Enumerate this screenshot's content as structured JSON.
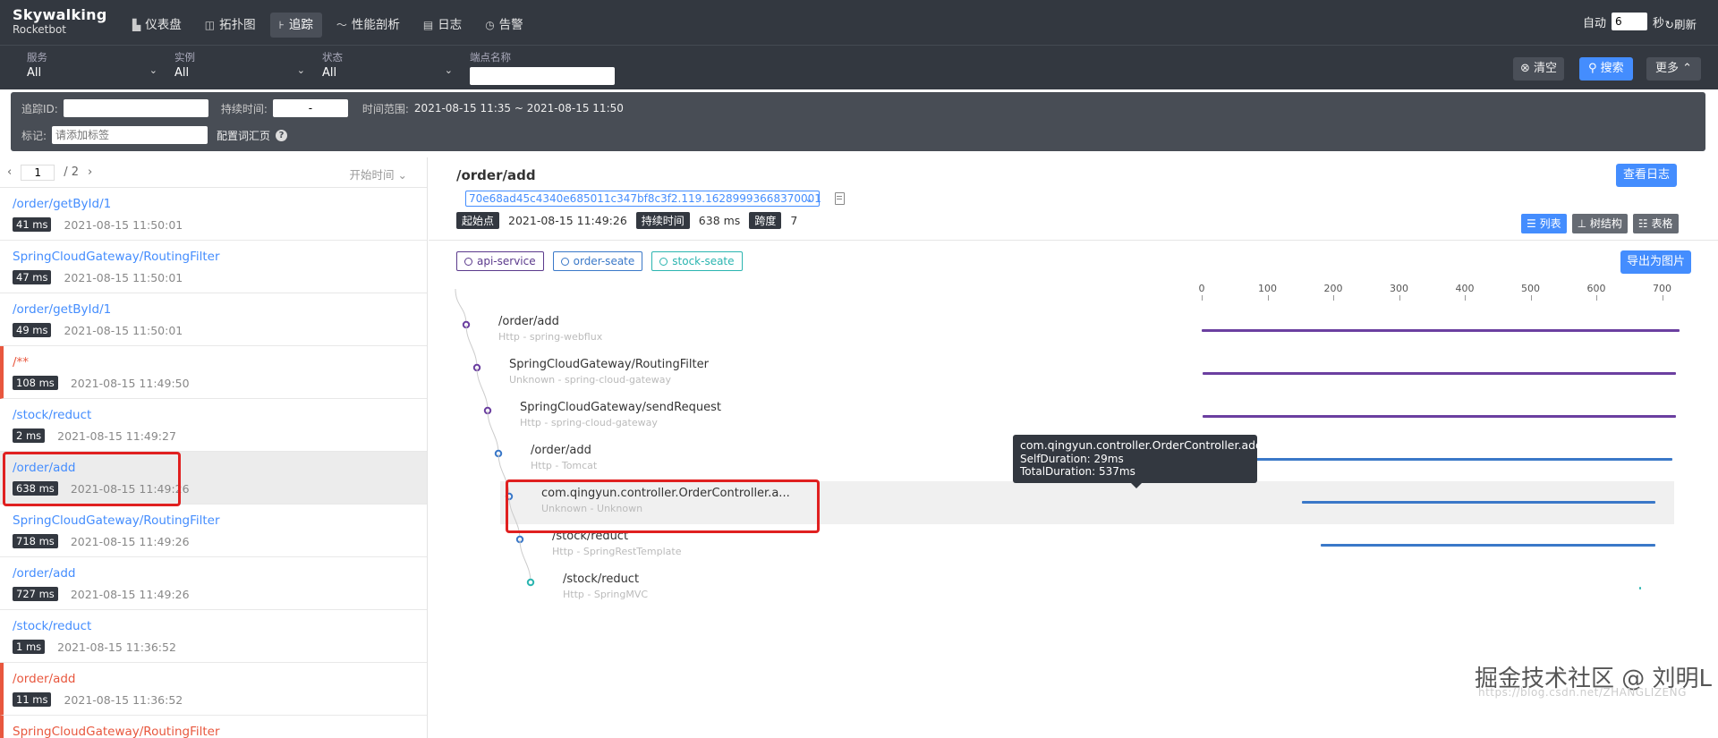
{
  "app": {
    "logo_line1": "Skywalking",
    "logo_line2": "Rocketbot",
    "nav": [
      {
        "label": "仪表盘",
        "icon": "bar-chart-icon"
      },
      {
        "label": "拓扑图",
        "icon": "topology-icon"
      },
      {
        "label": "追踪",
        "icon": "trace-icon"
      },
      {
        "label": "性能剖析",
        "icon": "profile-icon"
      },
      {
        "label": "日志",
        "icon": "log-icon"
      },
      {
        "label": "告警",
        "icon": "alarm-icon"
      }
    ],
    "active_nav": "追踪",
    "auto_label": "自动",
    "auto_value": "6",
    "auto_unit": "秒",
    "refresh_label": "刷新"
  },
  "filters": {
    "service": {
      "label": "服务",
      "value": "All"
    },
    "instance": {
      "label": "实例",
      "value": "All"
    },
    "status": {
      "label": "状态",
      "value": "All"
    },
    "endpoint": {
      "label": "端点名称",
      "value": ""
    },
    "clear_label": "清空",
    "search_label": "搜索",
    "more_label": "更多"
  },
  "advanced": {
    "trace_id_label": "追踪ID:",
    "trace_id_value": "",
    "duration_label": "持续时间:",
    "duration_value": "-",
    "time_range_label": "时间范围:",
    "time_range_value": "2021-08-15 11:35 ~ 2021-08-15 11:50",
    "tags_label": "标记:",
    "tags_placeholder": "请添加标签",
    "config_label": "配置词汇页"
  },
  "pager": {
    "current": "1",
    "total": "/ 2",
    "sort_label": "开始时间"
  },
  "traces": [
    {
      "name": "/order/getById/1",
      "duration": "41 ms",
      "time": "2021-08-15 11:50:01",
      "error": false
    },
    {
      "name": "SpringCloudGateway/RoutingFilter",
      "duration": "47 ms",
      "time": "2021-08-15 11:50:01",
      "error": false
    },
    {
      "name": "/order/getById/1",
      "duration": "49 ms",
      "time": "2021-08-15 11:50:01",
      "error": false
    },
    {
      "name": "/**",
      "duration": "108 ms",
      "time": "2021-08-15 11:49:50",
      "error": true
    },
    {
      "name": "/stock/reduct",
      "duration": "2 ms",
      "time": "2021-08-15 11:49:27",
      "error": false
    },
    {
      "name": "/order/add",
      "duration": "638 ms",
      "time": "2021-08-15 11:49:26",
      "error": false,
      "selected": true
    },
    {
      "name": "SpringCloudGateway/RoutingFilter",
      "duration": "718 ms",
      "time": "2021-08-15 11:49:26",
      "error": false
    },
    {
      "name": "/order/add",
      "duration": "727 ms",
      "time": "2021-08-15 11:49:26",
      "error": false
    },
    {
      "name": "/stock/reduct",
      "duration": "1 ms",
      "time": "2021-08-15 11:36:52",
      "error": false
    },
    {
      "name": "/order/add",
      "duration": "11 ms",
      "time": "2021-08-15 11:36:52",
      "error": true
    },
    {
      "name": "SpringCloudGateway/RoutingFilter",
      "duration": "",
      "time": "",
      "error": true
    }
  ],
  "detail": {
    "title": "/order/add",
    "view_log_label": "查看日志",
    "trace_id": "70e68ad45c4340e685011c347bf8c3f2.119.16289993668370001",
    "start_label": "起始点",
    "start_value": "2021-08-15 11:49:26",
    "duration_label": "持续时间",
    "duration_value": "638 ms",
    "span_label": "跨度",
    "span_value": "7",
    "view_list": "列表",
    "view_tree": "树结构",
    "view_table": "表格",
    "export_label": "导出为图片",
    "services": [
      {
        "name": "api-service",
        "color": "#5b3a8c"
      },
      {
        "name": "order-seate",
        "color": "#3a78c8"
      },
      {
        "name": "stock-seate",
        "color": "#2bb5b0"
      }
    ],
    "axis_ticks": [
      "0",
      "100",
      "200",
      "300",
      "400",
      "500",
      "600",
      "700"
    ],
    "spans": [
      {
        "name": "/order/add",
        "sub": "Http - spring-webflux",
        "depth": 0,
        "start": 0,
        "end": 727,
        "color": "#6b3fa0"
      },
      {
        "name": "SpringCloudGateway/RoutingFilter",
        "sub": "Unknown - spring-cloud-gateway",
        "depth": 1,
        "start": 1,
        "end": 721,
        "color": "#6b3fa0"
      },
      {
        "name": "SpringCloudGateway/sendRequest",
        "sub": "Http - spring-cloud-gateway",
        "depth": 2,
        "start": 2,
        "end": 721,
        "color": "#6b3fa0"
      },
      {
        "name": "/order/add",
        "sub": "Http - Tomcat",
        "depth": 3,
        "start": 65,
        "end": 716,
        "color": "#3a78c8"
      },
      {
        "name": "com.qingyun.controller.OrderController.a...",
        "sub": "Unknown - Unknown",
        "depth": 4,
        "start": 152,
        "end": 690,
        "color": "#3a78c8",
        "highlight": true
      },
      {
        "name": "/stock/reduct",
        "sub": "Http - SpringRestTemplate",
        "depth": 5,
        "start": 181,
        "end": 690,
        "color": "#3a78c8"
      },
      {
        "name": "/stock/reduct",
        "sub": "Http - SpringMVC",
        "depth": 6,
        "start": 665,
        "end": 667,
        "color": "#2bb5b0"
      }
    ],
    "tooltip": {
      "title": "com.qingyun.controller.OrderController.add()",
      "self": "SelfDuration: 29ms",
      "total": "TotalDuration: 537ms"
    }
  },
  "watermark": "掘金技术社区 @ 刘明L",
  "watermark_sub": "https://blog.csdn.net/ZHANGLIZENG"
}
